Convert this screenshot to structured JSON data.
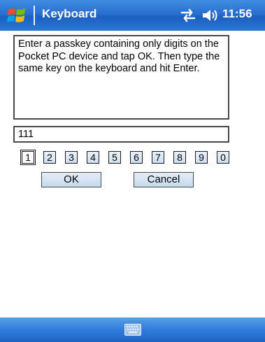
{
  "title_bar": {
    "title": "Keyboard",
    "clock": "11:56",
    "icons": [
      "windows-start-icon",
      "connectivity-icon",
      "volume-icon"
    ]
  },
  "instruction": {
    "text": "Enter a passkey containing only digits on the Pocket PC device and tap OK. Then type the same key on the keyboard and hit Enter."
  },
  "passkey": {
    "value": "111"
  },
  "digit_keys": [
    {
      "label": "1",
      "selected": true
    },
    {
      "label": "2",
      "selected": false
    },
    {
      "label": "3",
      "selected": false
    },
    {
      "label": "4",
      "selected": false
    },
    {
      "label": "5",
      "selected": false
    },
    {
      "label": "6",
      "selected": false
    },
    {
      "label": "7",
      "selected": false
    },
    {
      "label": "8",
      "selected": false
    },
    {
      "label": "9",
      "selected": false
    },
    {
      "label": "0",
      "selected": false
    }
  ],
  "buttons": {
    "ok_label": "OK",
    "cancel_label": "Cancel"
  },
  "menu_bar": {
    "icons": [
      "keyboard-icon"
    ]
  },
  "colors": {
    "titlebar_blue": "#2a6fcf",
    "menubar_blue": "#2f7cd8",
    "button_fill": "#c6d9ef"
  }
}
